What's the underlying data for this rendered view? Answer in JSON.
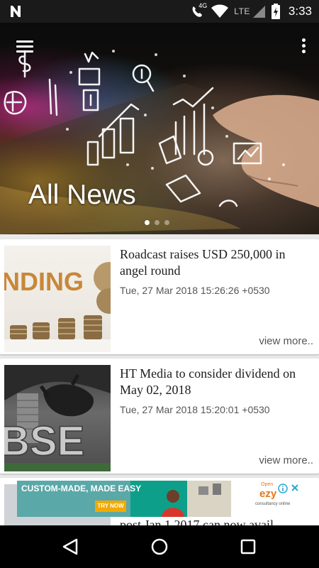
{
  "status_bar": {
    "time": "3:33",
    "network": "LTE",
    "network_small": "4G",
    "icons": [
      "notification-n-icon",
      "phone-wifi-icon",
      "wifi-icon",
      "signal-icon",
      "battery-charging-icon"
    ]
  },
  "header": {
    "title": "All News",
    "menu_icon": "hamburger-menu-icon",
    "overflow_icon": "more-vertical-icon",
    "carousel_pages": 3,
    "carousel_active": 1
  },
  "articles": [
    {
      "title": "Roadcast raises USD 250,000 in angel round",
      "date": "Tue, 27 Mar 2018 15:26:26 +0530",
      "more_label": "view more..",
      "thumb_text": "NDING"
    },
    {
      "title": "HT Media to consider dividend on May 02, 2018",
      "date": "Tue, 27 Mar 2018 15:20:01 +0530",
      "more_label": "view more..",
      "thumb_text": "BSE"
    },
    {
      "title_partial": "post Jan 1 2017 can now avail"
    }
  ],
  "ad": {
    "headline": "CUSTOM-MADE, MADE EASY",
    "cta": "TRY NOW",
    "brand": "ezy",
    "brand_sub": "consultancy online",
    "brand_top": "Open"
  },
  "nav": {
    "back_icon": "back-triangle-icon",
    "home_icon": "home-circle-icon",
    "recents_icon": "recents-square-icon"
  },
  "colors": {
    "status_bar": "#1a1a1a",
    "nav_bar": "#000000",
    "background": "#e9e9e9",
    "card": "#ffffff",
    "ad_teal": "#0e9f8a",
    "ad_cta": "#f2a900"
  }
}
